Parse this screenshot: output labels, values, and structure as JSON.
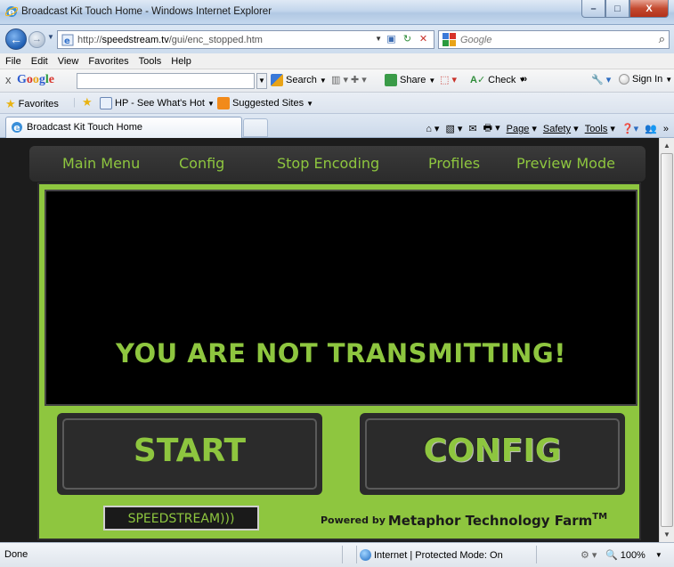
{
  "window": {
    "title": "Broadcast Kit Touch Home - Windows Internet Explorer",
    "minimize": "–",
    "maximize": "□",
    "close": "X"
  },
  "address_bar": {
    "url_prefix": "http://",
    "url_host": "speedstream.tv",
    "url_path": "/gui/enc_stopped.htm",
    "search_placeholder": "Google"
  },
  "menu": [
    "File",
    "Edit",
    "View",
    "Favorites",
    "Tools",
    "Help"
  ],
  "google_toolbar": {
    "close": "x",
    "logo": [
      "G",
      "o",
      "o",
      "g",
      "l",
      "e"
    ],
    "search": "Search",
    "share": "Share",
    "check": "Check",
    "more": "»",
    "sign_in": "Sign In"
  },
  "favorites_bar": {
    "favorites": "Favorites",
    "hp_link": "HP - See What's Hot",
    "suggested": "Suggested Sites"
  },
  "tab": {
    "label": "Broadcast Kit Touch Home"
  },
  "command_bar": {
    "page": "Page",
    "safety": "Safety",
    "tools": "Tools",
    "more": "»"
  },
  "app": {
    "nav": [
      "Main Menu",
      "Config",
      "Stop Encoding",
      "Profiles",
      "Preview Mode"
    ],
    "status_message": "YOU ARE NOT TRANSMITTING!",
    "start_label": "START",
    "config_label": "CONFIG",
    "logo_text": "SPEEDSTREAM)))",
    "powered_by": "Powered by",
    "company": "Metaphor Technology Farm",
    "trademark": "TM"
  },
  "status_bar": {
    "left": "Done",
    "zone": "Internet | Protected Mode: On",
    "zoom": "100%"
  },
  "colors": {
    "accent_green": "#8ec63f",
    "panel_dark": "#2b2b2b"
  }
}
